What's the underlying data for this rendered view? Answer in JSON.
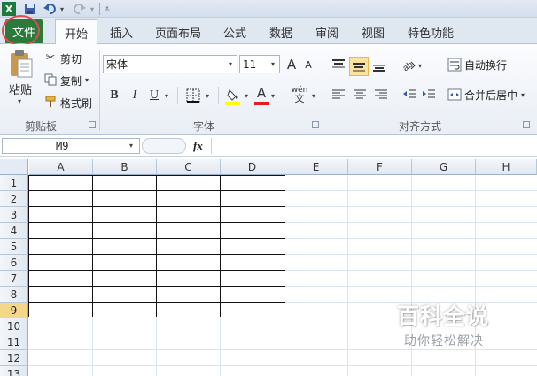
{
  "quick_access": {
    "undo_icon": "undo-icon",
    "redo_icon": "redo-icon",
    "save_icon": "save-icon",
    "app_icon": "excel-icon"
  },
  "tabs": {
    "file": "文件",
    "items": [
      "开始",
      "插入",
      "页面布局",
      "公式",
      "数据",
      "审阅",
      "视图",
      "特色功能"
    ],
    "active": "开始"
  },
  "clipboard": {
    "paste": "粘贴",
    "cut": "剪切",
    "copy": "复制",
    "format_painter": "格式刷",
    "label": "剪贴板"
  },
  "font": {
    "name": "宋体",
    "size": "11",
    "grow": "A",
    "shrink": "A",
    "bold": "B",
    "italic": "I",
    "underline": "U",
    "font_color_glyph": "A",
    "phonetic": "wén",
    "label": "字体",
    "fill_color": "#ffff00",
    "text_color": "#e02020"
  },
  "alignment": {
    "wrap_text": "自动换行",
    "merge_center": "合并后居中",
    "label": "对齐方式"
  },
  "formula_bar": {
    "name_box": "M9",
    "fx": "fx",
    "formula": ""
  },
  "sheet": {
    "columns": [
      "A",
      "B",
      "C",
      "D",
      "E",
      "F",
      "G",
      "H"
    ],
    "rows": [
      "1",
      "2",
      "3",
      "4",
      "5",
      "6",
      "7",
      "8",
      "9",
      "10",
      "11",
      "12",
      "13"
    ],
    "selected_row": "9"
  },
  "watermark": {
    "title": "百科全说",
    "subtitle": "助你轻松解决"
  }
}
